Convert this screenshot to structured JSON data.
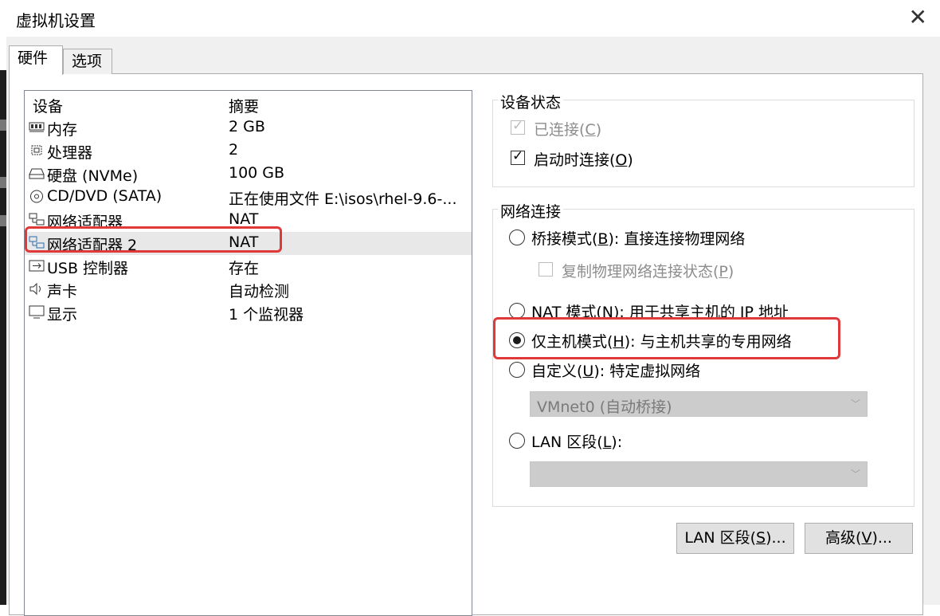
{
  "window": {
    "title": "虚拟机设置",
    "close_glyph": "✕"
  },
  "tabs": [
    {
      "label": "硬件",
      "active": true
    },
    {
      "label": "选项",
      "active": false
    }
  ],
  "device_list": {
    "col_device": "设备",
    "col_summary": "摘要",
    "rows": [
      {
        "icon": "memory-icon",
        "name": "内存",
        "summary": "2 GB"
      },
      {
        "icon": "processor-icon",
        "name": "处理器",
        "summary": "2"
      },
      {
        "icon": "hard-disk-icon",
        "name": "硬盘 (NVMe)",
        "summary": "100 GB"
      },
      {
        "icon": "cd-dvd-icon",
        "name": "CD/DVD (SATA)",
        "summary": "正在使用文件 E:\\isos\\rhel-9.6-..."
      },
      {
        "icon": "network-adapter-icon",
        "name": "网络适配器",
        "summary": "NAT"
      },
      {
        "icon": "network-adapter-icon",
        "name": "网络适配器 2",
        "summary": "NAT",
        "selected": true
      },
      {
        "icon": "usb-icon",
        "name": "USB 控制器",
        "summary": "存在"
      },
      {
        "icon": "sound-card-icon",
        "name": "声卡",
        "summary": "自动检测"
      },
      {
        "icon": "display-icon",
        "name": "显示",
        "summary": "1 个监视器"
      }
    ]
  },
  "device_status": {
    "title": "设备状态",
    "connected": {
      "text": "已连接(",
      "key": "C",
      "suffix": ")",
      "checked": true,
      "enabled": false
    },
    "connect_at_power_on": {
      "text": "启动时连接(",
      "key": "O",
      "suffix": ")",
      "checked": true,
      "enabled": true
    }
  },
  "network_connection": {
    "title": "网络连接",
    "bridged": {
      "text": "桥接模式(",
      "key": "B",
      "suffix": "): 直接连接物理网络",
      "selected": false
    },
    "replicate": {
      "text": "复制物理网络连接状态(",
      "key": "P",
      "suffix": ")",
      "checked": false,
      "enabled": false
    },
    "nat": {
      "text": "NAT 模式(",
      "key": "N",
      "suffix": "): 用于共享主机的 IP 地址",
      "selected": false
    },
    "host_only": {
      "text": "仅主机模式(",
      "key": "H",
      "suffix": "): 与主机共享的专用网络",
      "selected": true
    },
    "custom": {
      "text": "自定义(",
      "key": "U",
      "suffix": "): 特定虚拟网络",
      "selected": false
    },
    "custom_select_value": "VMnet0 (自动桥接)",
    "lan_segment": {
      "text": "LAN 区段(",
      "key": "L",
      "suffix": "):",
      "selected": false
    },
    "lan_select_value": ""
  },
  "buttons": {
    "lan_segments": {
      "text": "LAN 区段(",
      "key": "S",
      "suffix": ")..."
    },
    "advanced": {
      "text": "高级(",
      "key": "V",
      "suffix": ")..."
    }
  },
  "colors": {
    "highlight": "#e0393a",
    "dialog_bg": "#f0f0f0"
  }
}
